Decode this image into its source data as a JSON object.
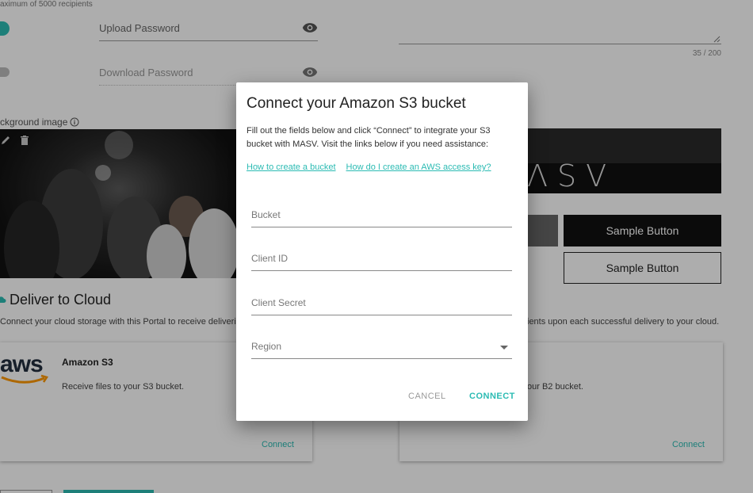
{
  "background": {
    "recipients_note": "aximum of 5000 recipients",
    "upload_password": {
      "label": "Upload Password"
    },
    "download_password": {
      "label": "Download Password"
    },
    "char_count": "35 / 200",
    "background_image": {
      "label": "ckground image"
    },
    "brand_logo": "ΛSV",
    "sample_button_1": "Sample Button",
    "sample_button_2": "Sample Button",
    "deliver_section": {
      "title": "Deliver to Cloud",
      "description_left": "Connect your cloud storage with this Portal to receive deliveries",
      "description_right": "ients upon each successful delivery to your cloud."
    },
    "cards": [
      {
        "logo": "aws",
        "title": "Amazon S3",
        "description": "Receive files to your S3 bucket.",
        "link": "Connect"
      },
      {
        "description": "our B2 bucket.",
        "link": "Connect"
      }
    ]
  },
  "dialog": {
    "title": "Connect your Amazon S3 bucket",
    "body": "Fill out the fields below and click “Connect” to integrate your S3 bucket with MASV. Visit the links below if you need assistance:",
    "links": [
      "How to create a bucket",
      "How do I create an AWS access key?"
    ],
    "fields": {
      "bucket": "Bucket",
      "client_id": "Client ID",
      "client_secret": "Client Secret",
      "region": "Region"
    },
    "cancel_label": "CANCEL",
    "connect_label": "CONNECT"
  },
  "colors": {
    "accent": "#2bbbb3",
    "overlay": "rgba(0,0,0,0.32)"
  }
}
